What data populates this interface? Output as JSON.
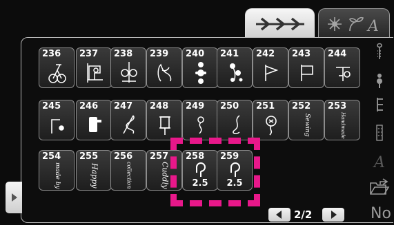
{
  "tabs": [
    {
      "icon": "decorative-stitch-icon",
      "active": true
    },
    {
      "icon": "flower-leaf-letter-icon",
      "active": false
    }
  ],
  "stitches": [
    {
      "number": "236",
      "icon": "bicycle-icon"
    },
    {
      "number": "237",
      "icon": "sewing-machine-icon"
    },
    {
      "number": "238",
      "icon": "scissors-icon"
    },
    {
      "number": "239",
      "icon": "glove-icon"
    },
    {
      "number": "240",
      "icon": "flower-chain-icon"
    },
    {
      "number": "241",
      "icon": "flower-sprig-icon"
    },
    {
      "number": "242",
      "icon": "flag-icon"
    },
    {
      "number": "243",
      "icon": "flag-pennant-icon"
    },
    {
      "number": "244",
      "icon": "button-icon"
    },
    {
      "number": "245",
      "icon": "pin-icon"
    },
    {
      "number": "246",
      "icon": "dress-form-icon"
    },
    {
      "number": "247",
      "icon": "needle-thread-icon"
    },
    {
      "number": "248",
      "icon": "thread-spool-icon"
    },
    {
      "number": "249",
      "icon": "bee-icon"
    },
    {
      "number": "250",
      "icon": "needle-thread-icon"
    },
    {
      "number": "251",
      "icon": "button-thread-icon"
    },
    {
      "number": "252",
      "word": "Sewing"
    },
    {
      "number": "253",
      "word": "Handmade"
    },
    {
      "number": "254",
      "word": "made by"
    },
    {
      "number": "255",
      "word": "Happy"
    },
    {
      "number": "256",
      "word": "collection"
    },
    {
      "number": "257",
      "word": "Cuddly"
    },
    {
      "number": "258",
      "icon": "buttonhole-icon",
      "value": "2.5"
    },
    {
      "number": "259",
      "icon": "buttonhole-icon",
      "value": "2.5"
    }
  ],
  "pager": {
    "label": "2/2"
  },
  "side_icons": [
    "needle-icon",
    "stitch-bee-icon",
    "stitch-scale-icon",
    "stitch-dots-icon",
    "letter-a-icon",
    "open-folder-icon"
  ],
  "side_letter": "A",
  "no_label": "No",
  "colors": {
    "selection": "#e8188a"
  }
}
